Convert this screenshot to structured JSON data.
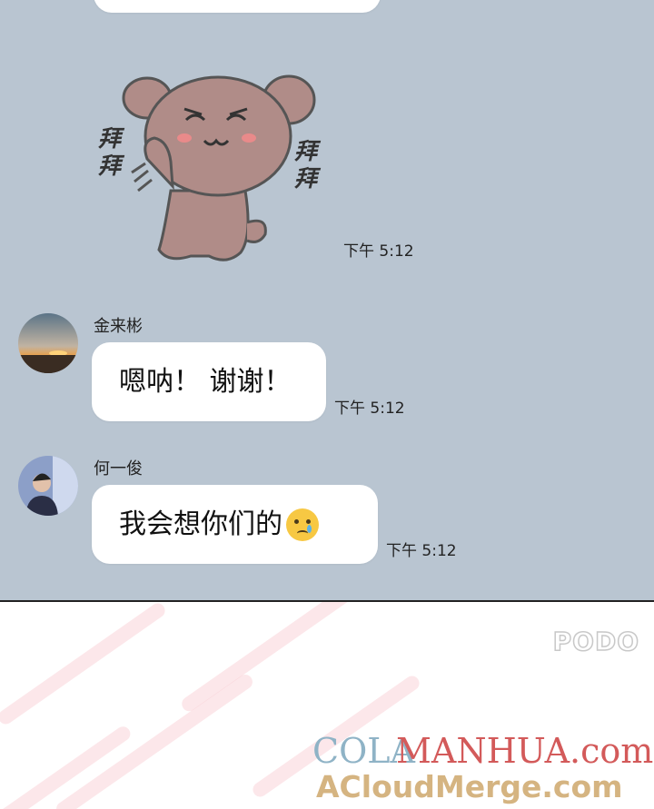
{
  "messages": {
    "sticker": {
      "label": "拜拜",
      "time": "下午 5:12"
    },
    "msg1": {
      "sender": "金来彬",
      "text": "嗯呐！ 谢谢！",
      "time": "下午 5:12"
    },
    "msg2": {
      "sender": "何一俊",
      "text": "我会想你们的",
      "emoji": "😢",
      "time": "下午 5:12"
    }
  },
  "watermarks": {
    "podo": "PODO",
    "cola_part1": "COLA",
    "cola_part2": "MANHUA.com",
    "cloud": "ACloudMerge.com"
  },
  "colors": {
    "chat_background": "#b9c5d1",
    "bubble": "#ffffff",
    "sticker_dog": "#b08c88"
  }
}
